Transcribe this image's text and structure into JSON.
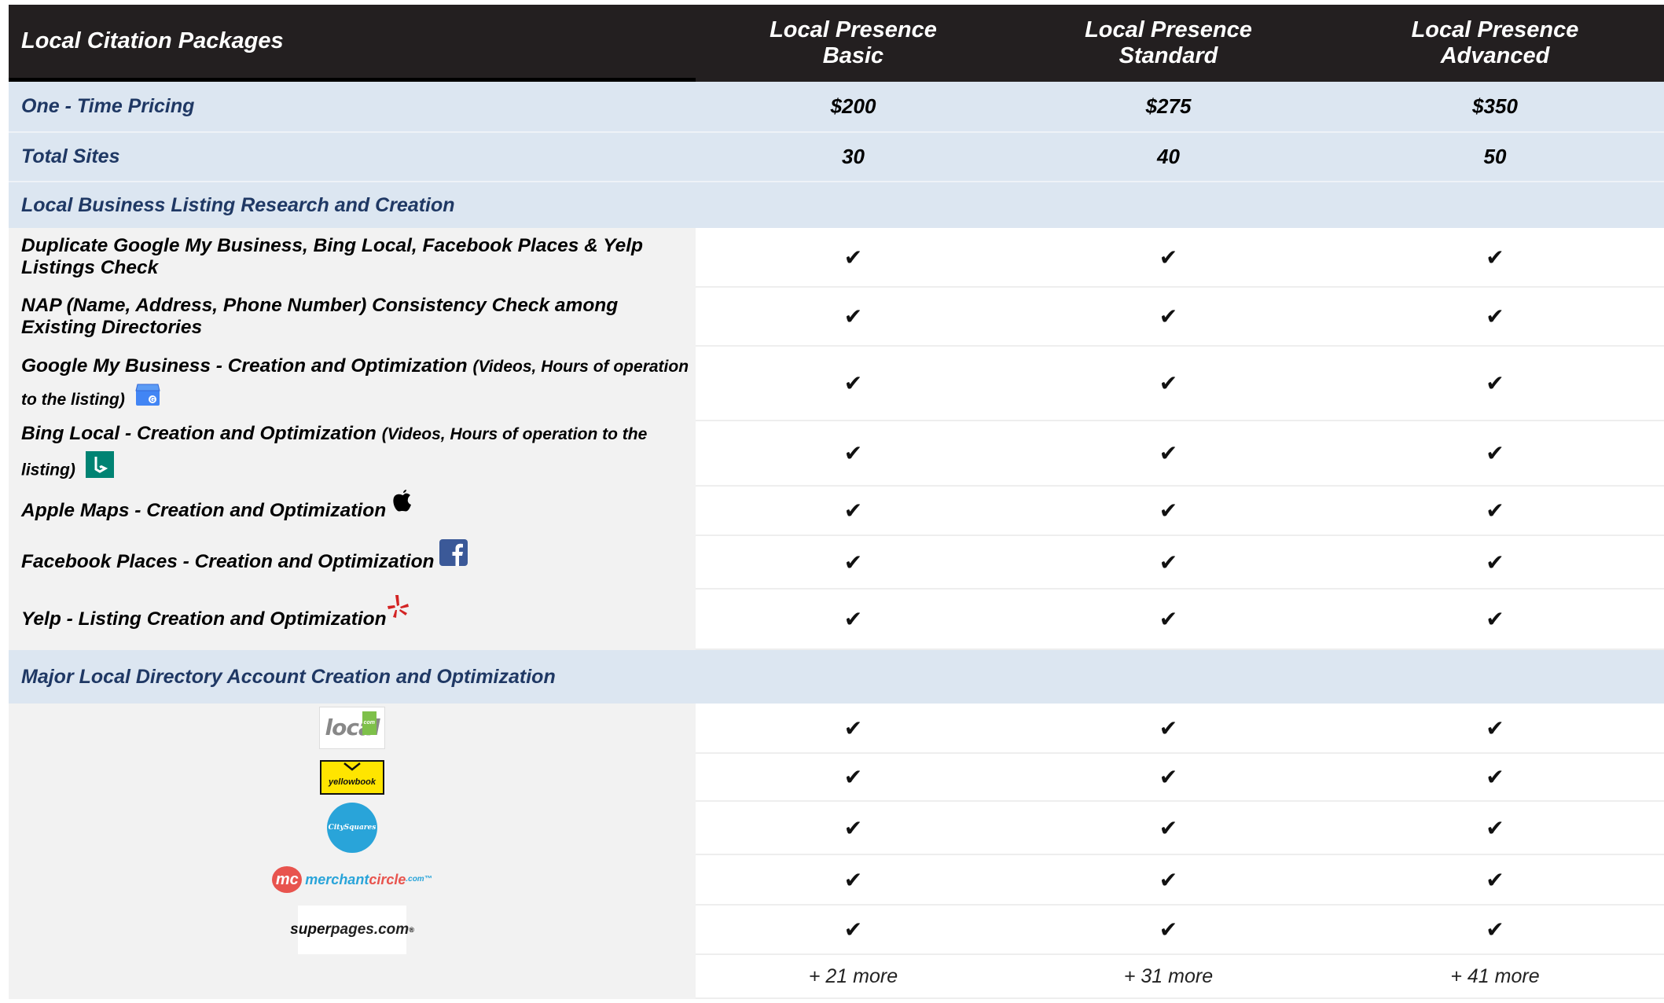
{
  "header": {
    "title": "Local Citation Packages",
    "plans": [
      {
        "line1": "Local Presence",
        "line2": "Basic"
      },
      {
        "line1": "Local Presence",
        "line2": "Standard"
      },
      {
        "line1": "Local Presence",
        "line2": "Advanced"
      }
    ]
  },
  "pricing": {
    "label": "One - Time Pricing",
    "values": [
      "$200",
      "$275",
      "$350"
    ]
  },
  "total_sites": {
    "label": "Total Sites",
    "values": [
      "30",
      "40",
      "50"
    ]
  },
  "section1": {
    "title": "Local Business Listing Research and Creation",
    "rows": [
      {
        "main": "Duplicate Google My Business, Bing Local, Facebook Places & Yelp Listings Check",
        "note": "",
        "icon": ""
      },
      {
        "main": "NAP (Name, Address, Phone Number) Consistency Check among Existing Directories",
        "note": "",
        "icon": ""
      },
      {
        "main": "Google My Business - Creation and Optimization",
        "note": "(Videos, Hours of operation to the listing)",
        "icon": "google-my-business-icon"
      },
      {
        "main": "Bing Local - Creation and Optimization",
        "note": "(Videos, Hours of operation to the listing)",
        "icon": "bing-icon"
      },
      {
        "main": "Apple Maps - Creation and Optimization",
        "note": "",
        "icon": "apple-icon"
      },
      {
        "main": "Facebook Places - Creation and Optimization",
        "note": "",
        "icon": "facebook-icon"
      },
      {
        "main": "Yelp - Listing Creation and Optimization",
        "note": "",
        "icon": "yelp-icon"
      }
    ]
  },
  "section2": {
    "title": "Major Local Directory Account Creation and Optimization",
    "logos": [
      {
        "text": "local",
        "badge": "com"
      },
      {
        "text": "yellowbook"
      },
      {
        "text": "CitySquares"
      },
      {
        "mc": "mc",
        "text1": "merchant",
        "text2": "circle",
        "text3": ".com™"
      },
      {
        "text1": "super",
        "text2": "pages.com",
        "mark": "®"
      }
    ]
  },
  "check_glyph": "✔",
  "more": [
    "+ 21 more",
    "+ 31 more",
    "+ 41 more"
  ],
  "colors": {
    "header_bg": "#231f20",
    "row_blue": "#dce6f1",
    "label_navy": "#1f3864",
    "feature_gray": "#f2f2f2"
  }
}
